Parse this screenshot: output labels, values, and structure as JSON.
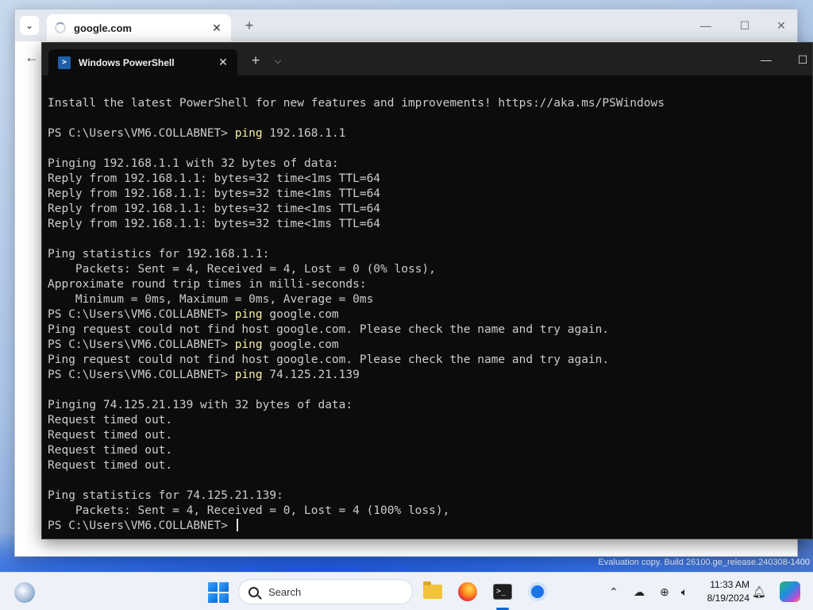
{
  "browser": {
    "tab_title": "google.com",
    "new_tab_label": "+",
    "minimize_label": "—",
    "maximize_label": "☐",
    "close_label": "✕"
  },
  "terminal": {
    "tab_title": "Windows PowerShell",
    "tab_close_label": "✕",
    "new_tab_label": "+",
    "dropdown_label": "⌵",
    "minimize_label": "—",
    "maximize_label": "☐",
    "lines": [
      {
        "text": "Install the latest PowerShell for new features and improvements! https://aka.ms/PSWindows"
      },
      {
        "text": ""
      },
      {
        "prompt": "PS C:\\Users\\VM6.COLLABNET> ",
        "cmd": "ping",
        "args": " 192.168.1.1"
      },
      {
        "text": ""
      },
      {
        "text": "Pinging 192.168.1.1 with 32 bytes of data:"
      },
      {
        "text": "Reply from 192.168.1.1: bytes=32 time<1ms TTL=64"
      },
      {
        "text": "Reply from 192.168.1.1: bytes=32 time<1ms TTL=64"
      },
      {
        "text": "Reply from 192.168.1.1: bytes=32 time<1ms TTL=64"
      },
      {
        "text": "Reply from 192.168.1.1: bytes=32 time<1ms TTL=64"
      },
      {
        "text": ""
      },
      {
        "text": "Ping statistics for 192.168.1.1:"
      },
      {
        "text": "    Packets: Sent = 4, Received = 4, Lost = 0 (0% loss),"
      },
      {
        "text": "Approximate round trip times in milli-seconds:"
      },
      {
        "text": "    Minimum = 0ms, Maximum = 0ms, Average = 0ms"
      },
      {
        "prompt": "PS C:\\Users\\VM6.COLLABNET> ",
        "cmd": "ping",
        "args": " google.com"
      },
      {
        "text": "Ping request could not find host google.com. Please check the name and try again."
      },
      {
        "prompt": "PS C:\\Users\\VM6.COLLABNET> ",
        "cmd": "ping",
        "args": " google.com"
      },
      {
        "text": "Ping request could not find host google.com. Please check the name and try again."
      },
      {
        "prompt": "PS C:\\Users\\VM6.COLLABNET> ",
        "cmd": "ping",
        "args": " 74.125.21.139"
      },
      {
        "text": ""
      },
      {
        "text": "Pinging 74.125.21.139 with 32 bytes of data:"
      },
      {
        "text": "Request timed out."
      },
      {
        "text": "Request timed out."
      },
      {
        "text": "Request timed out."
      },
      {
        "text": "Request timed out."
      },
      {
        "text": ""
      },
      {
        "text": "Ping statistics for 74.125.21.139:"
      },
      {
        "text": "    Packets: Sent = 4, Received = 0, Lost = 4 (100% loss),"
      },
      {
        "prompt": "PS C:\\Users\\VM6.COLLABNET> ",
        "cursor": true
      }
    ]
  },
  "desktop": {
    "evaluation_text": "Evaluation copy. Build 26100.ge_release.240308-1400"
  },
  "taskbar": {
    "search_placeholder": "Search",
    "time": "11:33 AM",
    "date": "8/19/2024",
    "tray_chevron": "⌃"
  },
  "colors": {
    "terminal_bg": "#0c0c0c",
    "terminal_text": "#cccccc",
    "command_highlight": "#f9f1a5",
    "accent": "#0a67d8"
  }
}
